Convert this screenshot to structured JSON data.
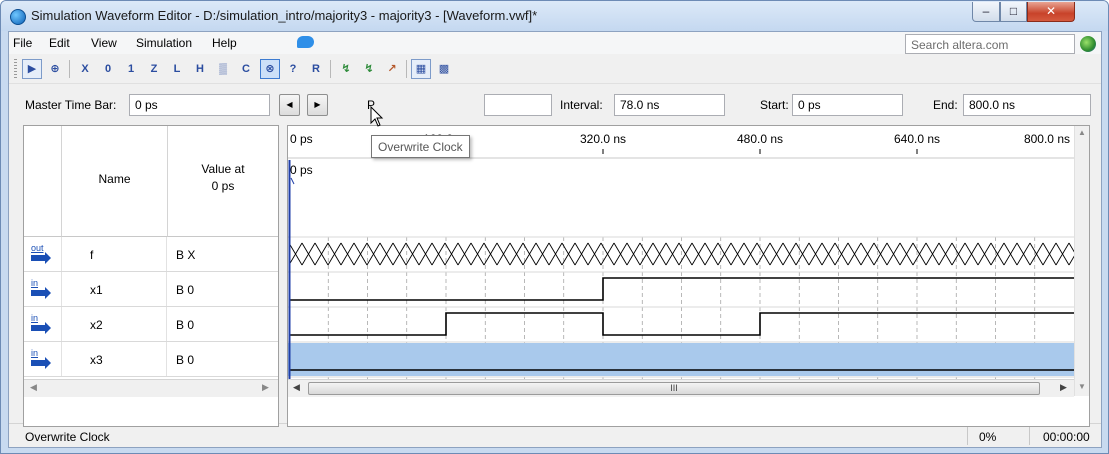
{
  "window": {
    "title": "Simulation Waveform Editor - D:/simulation_intro/majority3 - majority3 - [Waveform.vwf]*"
  },
  "menu": [
    "File",
    "Edit",
    "View",
    "Simulation",
    "Help"
  ],
  "search": {
    "placeholder": "Search altera.com"
  },
  "toolbar": {
    "icons": [
      "selection-tool-icon",
      "zoom-tool-icon",
      "forcing-unknown-icon",
      "forcing-low-icon",
      "forcing-high-icon",
      "high-impedance-icon",
      "weak-low-icon",
      "weak-high-icon",
      "invert-icon",
      "count-value-icon",
      "overwrite-clock-icon",
      "random-values-icon",
      "value-icon",
      "snap-to-grid-icon",
      "run-functional-simulation-icon",
      "run-timing-simulation-icon",
      "generate-netlist-icon",
      "grid-size-icon"
    ]
  },
  "timebar": {
    "master_label": "Master Time Bar:",
    "master_value": "0 ps",
    "pointer_label_visible": "P",
    "interval_label": "Interval:",
    "interval_value": "78.0 ns",
    "start_label": "Start:",
    "start_value": "0 ps",
    "end_label": "End:",
    "end_value": "800.0 ns"
  },
  "tooltip": "Overwrite Clock",
  "table": {
    "col_name": "Name",
    "col_value_line1": "Value at",
    "col_value_line2": "0 ps",
    "rows": [
      {
        "dir": "out",
        "name": "f",
        "value": "B X"
      },
      {
        "dir": "in",
        "name": "x1",
        "value": "B 0"
      },
      {
        "dir": "in",
        "name": "x2",
        "value": "B 0"
      },
      {
        "dir": "in",
        "name": "x3",
        "value": "B 0"
      }
    ]
  },
  "waveform": {
    "time_unit": "ns",
    "time_range": [
      0,
      800
    ],
    "tick_labels": [
      "0 ps",
      "160.0 ns",
      "320.0 ns",
      "480.0 ns",
      "640.0 ns",
      "800.0 ns"
    ],
    "marker_label": "0 ps",
    "scroll_thumb_label": "III",
    "signals": [
      {
        "name": "f",
        "type": "unknown",
        "transitions_ns": [],
        "initial": "X"
      },
      {
        "name": "x1",
        "type": "binary",
        "initial": 0,
        "transitions_ns": [
          320
        ]
      },
      {
        "name": "x2",
        "type": "binary",
        "initial": 0,
        "transitions_ns": [
          160,
          320,
          480
        ]
      },
      {
        "name": "x3",
        "type": "binary",
        "initial": 0,
        "transitions_ns": [],
        "selected": true
      }
    ],
    "colors": {
      "selection": "#a9c9ec",
      "marker": "#1f3ea8",
      "grid": "#9a9a9a"
    }
  },
  "status": {
    "text": "Overwrite Clock",
    "percent": "0%",
    "elapsed": "00:00:00"
  }
}
